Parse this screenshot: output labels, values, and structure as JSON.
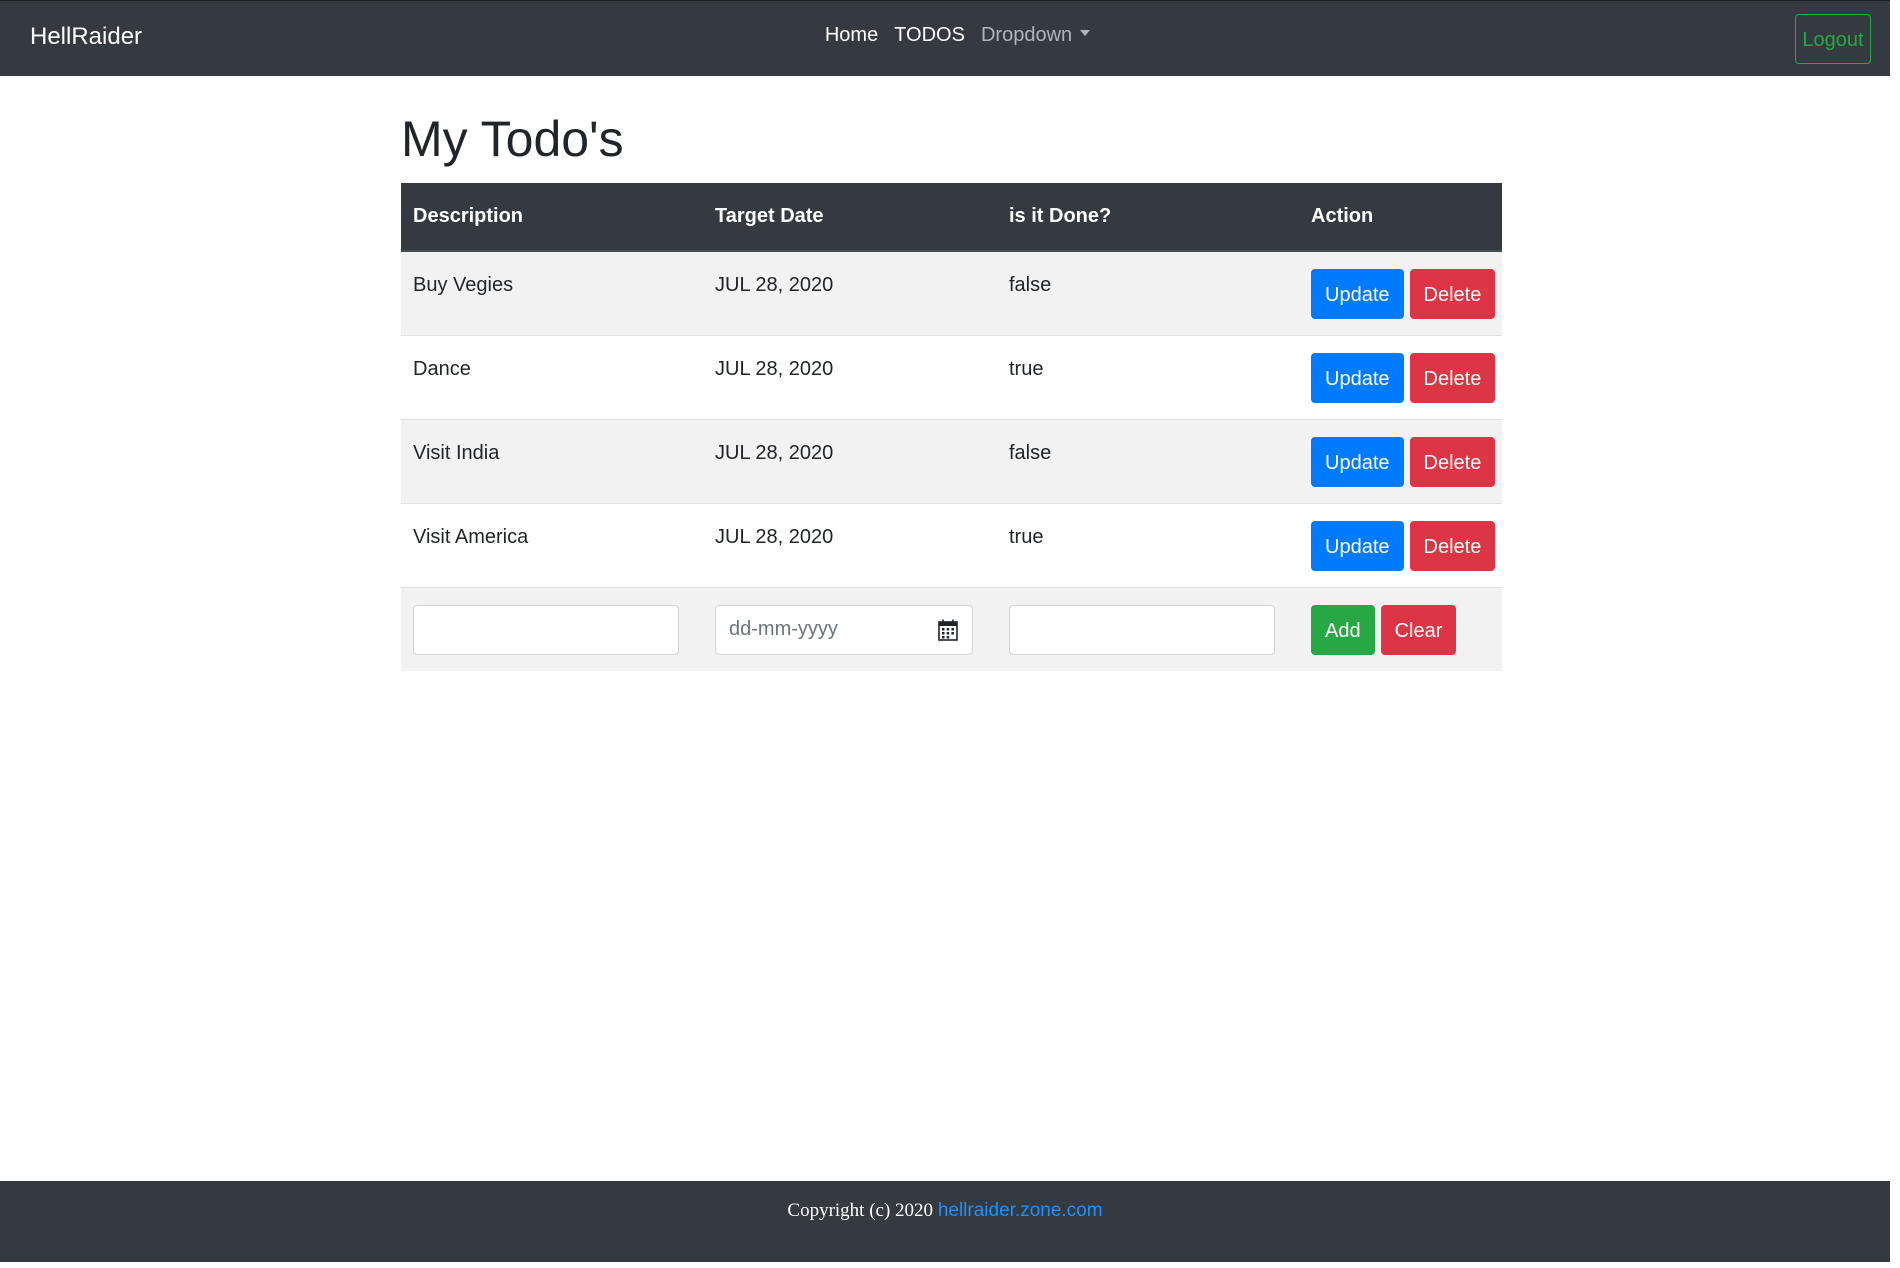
{
  "navbar": {
    "brand": "HellRaider",
    "links": [
      "Home",
      "TODOS",
      "Dropdown"
    ],
    "logout_label": "Logout"
  },
  "page_title": "My Todo's",
  "table": {
    "headers": [
      "Description",
      "Target Date",
      "is it Done?",
      "Action"
    ],
    "rows": [
      {
        "description": "Buy Vegies",
        "target_date": "JUL 28, 2020",
        "done": "false"
      },
      {
        "description": "Dance",
        "target_date": "JUL 28, 2020",
        "done": "true"
      },
      {
        "description": "Visit India",
        "target_date": "JUL 28, 2020",
        "done": "false"
      },
      {
        "description": "Visit America",
        "target_date": "JUL 28, 2020",
        "done": "true"
      }
    ],
    "update_label": "Update",
    "delete_label": "Delete"
  },
  "new_todo_form": {
    "description_value": "",
    "date_placeholder": "dd-mm-yyyy",
    "done_value": "",
    "add_label": "Add",
    "clear_label": "Clear"
  },
  "footer": {
    "copyright": "Copyright (c) 2020",
    "link_text": "hellraider.zone.com"
  },
  "colors": {
    "navbar_bg": "#343a40",
    "primary": "#007bff",
    "danger": "#dc3545",
    "success": "#28a745",
    "stripe": "#f2f2f2",
    "link": "#1e90ff"
  }
}
